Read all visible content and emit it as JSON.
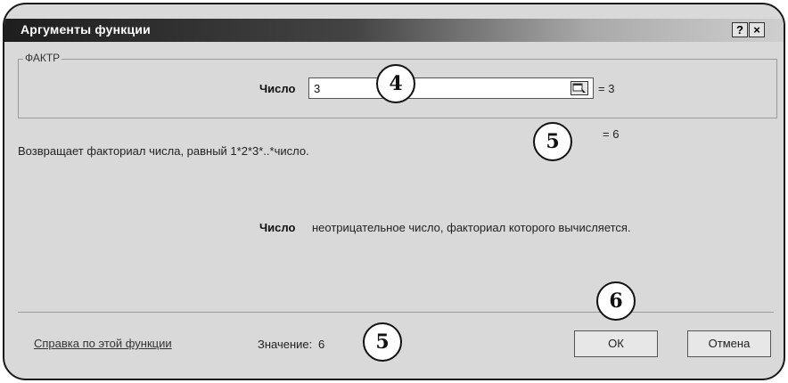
{
  "dialog": {
    "title": "Аргументы функции",
    "help_btn": "?",
    "close_btn": "×"
  },
  "function": {
    "name": "ФАКТР",
    "arg_label": "Число",
    "arg_value": "3",
    "arg_result": "= 3",
    "formula_result": "= 6",
    "description": "Возвращает факториал числа, равный 1*2*3*..*число.",
    "arg_help_label": "Число",
    "arg_help_text": "неотрицательное число, факториал которого вычисляется."
  },
  "footer": {
    "help_link": "Справка по этой функции",
    "value_label": "Значение:",
    "value": "6",
    "ok_label": "ОК",
    "cancel_label": "Отмена"
  },
  "callouts": {
    "c4": "4",
    "c5a": "5",
    "c5b": "5",
    "c6": "6"
  }
}
